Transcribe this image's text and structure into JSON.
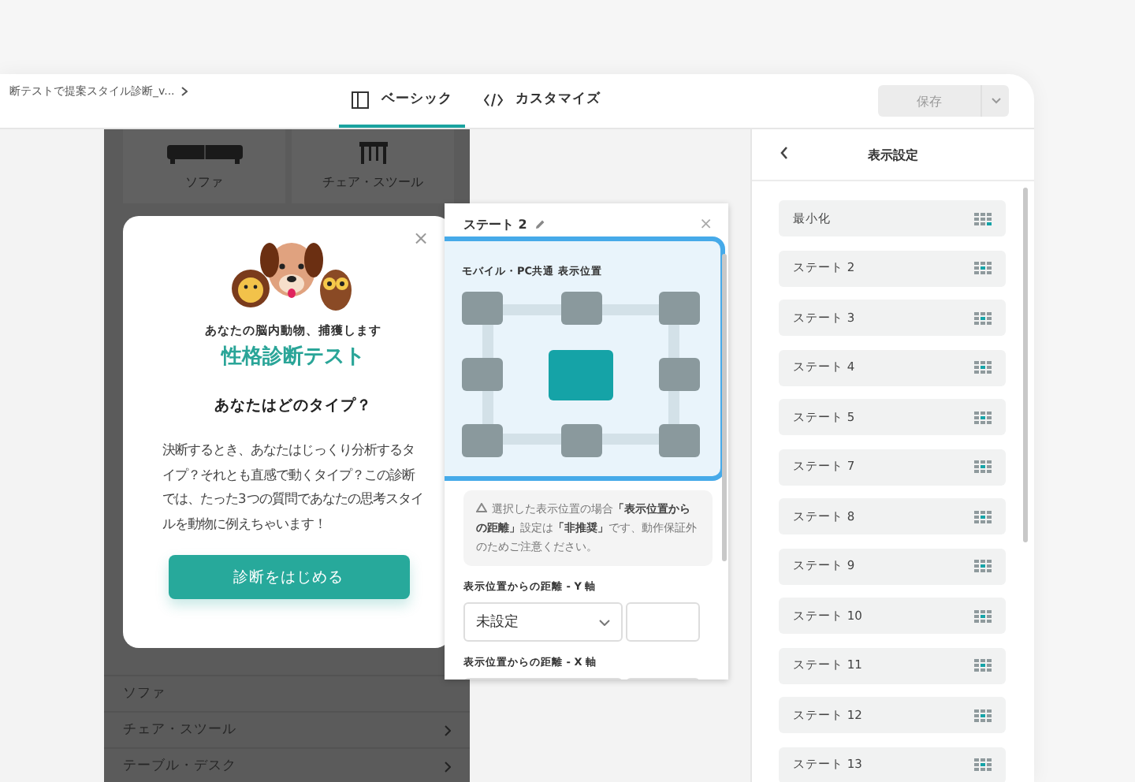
{
  "breadcrumb": "断テストで提案スタイル診断_v...",
  "tabs": [
    {
      "label": "ベーシック",
      "selected": true,
      "kind": "basic"
    },
    {
      "label": "カスタマイズ",
      "selected": false,
      "kind": "code"
    }
  ],
  "save_button": "保存",
  "preview": {
    "tiles": [
      {
        "label": "ソファ",
        "kind": "sofa"
      },
      {
        "label": "チェア・スツール",
        "kind": "chair"
      }
    ],
    "rows": [
      {
        "label": "ソファ",
        "has_arrow": false
      },
      {
        "label": "チェア・スツール",
        "has_arrow": true
      },
      {
        "label": "テーブル・デスク",
        "has_arrow": true
      }
    ]
  },
  "popup": {
    "close": "×",
    "subtitle": "あなたの脳内動物、捕獲します",
    "title": "性格診断テスト",
    "question": "あなたはどのタイプ？",
    "body": "決断するとき、あなたはじっくり分析するタイプ？それとも直感で動くタイプ？この診断では、たった3つの質問であなたの思考スタイルを動物に例えちゃいます！",
    "button": "診断をはじめる"
  },
  "state_panel": {
    "title": "ステート 2",
    "close": "×",
    "position_title": "モバイル・PC共通 表示位置",
    "positions": [
      {
        "selected": false
      },
      {
        "selected": false
      },
      {
        "selected": false
      },
      {
        "selected": false
      },
      {
        "selected": true
      },
      {
        "selected": false
      },
      {
        "selected": false
      },
      {
        "selected": false
      },
      {
        "selected": false
      }
    ],
    "note": "選択した表示位置の場合**「表示位置からの距離」**設定は**「非推奨」**です、動作保証外のためご注意ください。",
    "y_label": "表示位置からの距離 - Y 軸",
    "y_select": "未設定",
    "x_label": "表示位置からの距離 - X 軸"
  },
  "display_settings": {
    "title": "表示設定",
    "items": [
      {
        "label": "最小化",
        "kind": "minimized"
      },
      {
        "label": "ステート 2",
        "kind": "state"
      },
      {
        "label": "ステート 3",
        "kind": "state"
      },
      {
        "label": "ステート 4",
        "kind": "state"
      },
      {
        "label": "ステート 5",
        "kind": "state"
      },
      {
        "label": "ステート 7",
        "kind": "state"
      },
      {
        "label": "ステート 8",
        "kind": "state"
      },
      {
        "label": "ステート 9",
        "kind": "state"
      },
      {
        "label": "ステート 10",
        "kind": "state"
      },
      {
        "label": "ステート 11",
        "kind": "state"
      },
      {
        "label": "ステート 12",
        "kind": "state"
      },
      {
        "label": "ステート 13",
        "kind": "state"
      }
    ]
  }
}
